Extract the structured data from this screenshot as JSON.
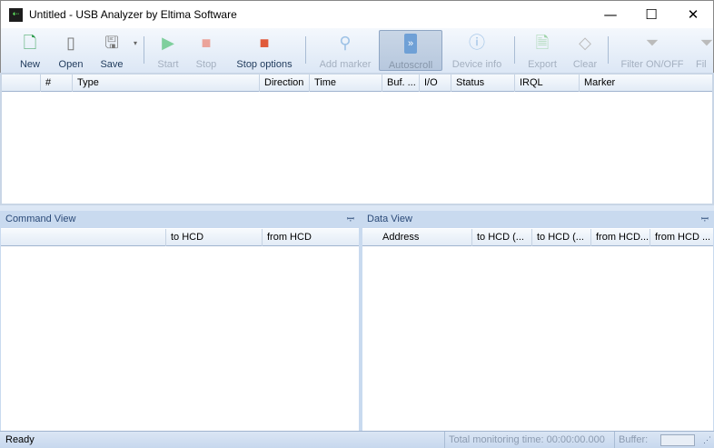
{
  "window": {
    "title": "Untitled - USB Analyzer by Eltima Software",
    "minimize": "—",
    "maximize": "☐",
    "close": "✕"
  },
  "toolbar": {
    "new": "New",
    "open": "Open",
    "save": "Save",
    "start": "Start",
    "stop": "Stop",
    "stop_options": "Stop options",
    "add_marker": "Add marker",
    "autoscroll": "Autoscroll",
    "device_info": "Device info",
    "export": "Export",
    "clear": "Clear",
    "filter": "Filter ON/OFF",
    "filter2": "Fil"
  },
  "main_table": {
    "columns": [
      "",
      "#",
      "Type",
      "Direction",
      "Time",
      "Buf. ...",
      "I/O",
      "Status",
      "IRQL",
      "Marker"
    ]
  },
  "command_view": {
    "title": "Command View",
    "columns": [
      "",
      "to HCD",
      "from HCD"
    ]
  },
  "data_view": {
    "title": "Data View",
    "columns": [
      "Address",
      "to HCD (...",
      "to HCD (...",
      "from HCD...",
      "from HCD ..."
    ]
  },
  "statusbar": {
    "status": "Ready",
    "monitoring": "Total monitoring time: 00:00:00.000",
    "buffer": "Buffer:"
  },
  "colors": {
    "accent": "#1e395b",
    "panel_header": "#c9daef"
  }
}
